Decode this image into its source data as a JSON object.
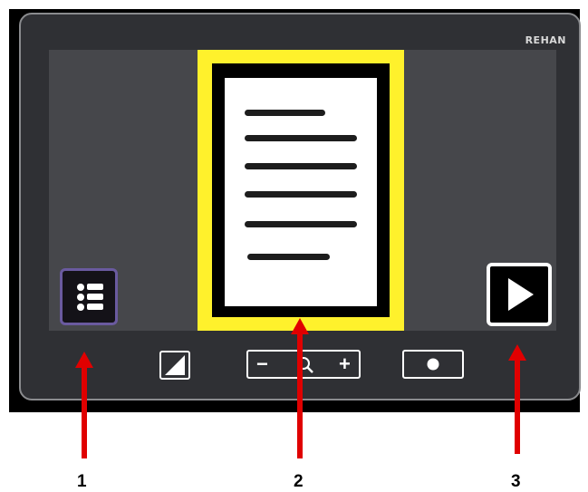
{
  "device": {
    "brand": "REHAN"
  },
  "toolbar": {
    "zoom_out_symbol": "−",
    "zoom_in_symbol": "+"
  },
  "callouts": [
    {
      "label": "1"
    },
    {
      "label": "2"
    },
    {
      "label": "3"
    }
  ],
  "icons": {
    "list": "list-icon",
    "play": "play-icon",
    "contrast": "contrast-icon",
    "zoom": "magnifier-icon",
    "record": "record-dot-icon"
  },
  "colors": {
    "bezel": "#2f3034",
    "screen": "#46474b",
    "highlight": "#fff12c",
    "menu_accent": "#6a5a9f",
    "callout_arrow": "#e00000"
  }
}
